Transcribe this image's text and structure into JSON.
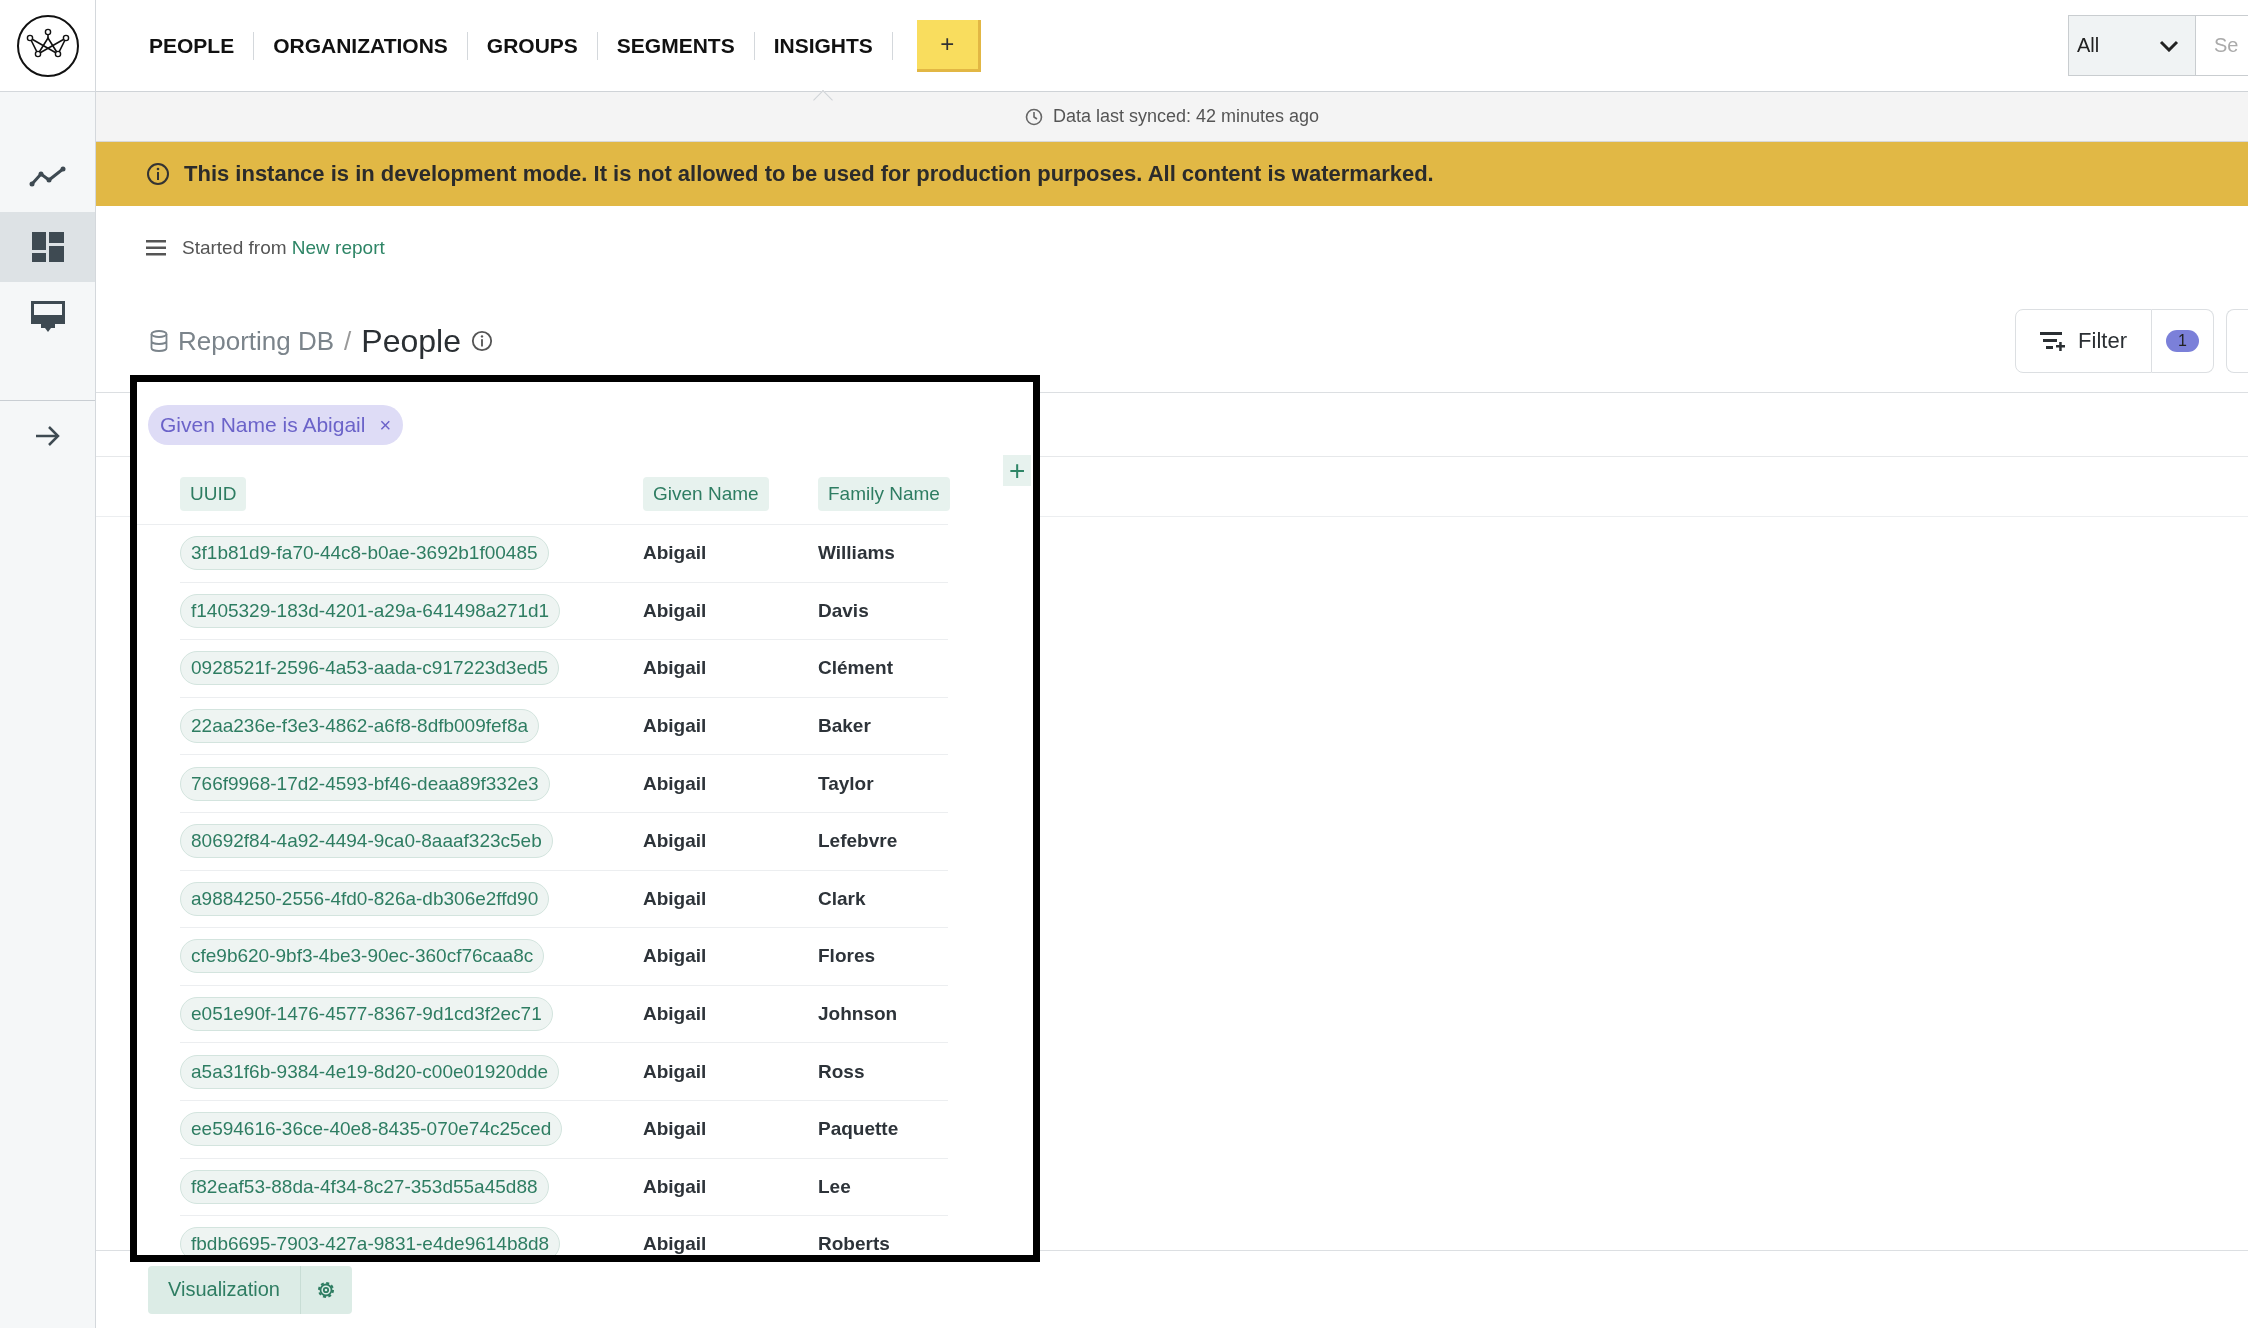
{
  "nav": {
    "items": [
      {
        "label": "PEOPLE",
        "selected": false
      },
      {
        "label": "ORGANIZATIONS",
        "selected": false
      },
      {
        "label": "GROUPS",
        "selected": false
      },
      {
        "label": "SEGMENTS",
        "selected": false
      },
      {
        "label": "INSIGHTS",
        "selected": true
      }
    ],
    "add_button": "+"
  },
  "scope_select": {
    "value": "All"
  },
  "search": {
    "placeholder": "Se"
  },
  "sync_status": "Data last synced: 42 minutes ago",
  "banner": "This instance is in development mode. It is not allowed to be used for production purposes. All content is watermarked.",
  "sidebar": {
    "items": [
      {
        "kind": "trend",
        "selected": false
      },
      {
        "kind": "dashboard",
        "selected": true
      },
      {
        "kind": "presentation",
        "selected": false
      }
    ]
  },
  "source": {
    "prefix": "Started from",
    "link": "New report"
  },
  "breadcrumb": {
    "database": "Reporting DB",
    "separator": "/",
    "table": "People"
  },
  "filter_button": {
    "label": "Filter",
    "count": "1"
  },
  "active_filters": [
    {
      "label": "Given Name is Abigail",
      "remove": "×"
    }
  ],
  "table": {
    "columns": [
      "UUID",
      "Given Name",
      "Family Name"
    ],
    "add_column": "+",
    "rows": [
      [
        "3f1b81d9-fa70-44c8-b0ae-3692b1f00485",
        "Abigail",
        "Williams"
      ],
      [
        "f1405329-183d-4201-a29a-641498a271d1",
        "Abigail",
        "Davis"
      ],
      [
        "0928521f-2596-4a53-aada-c917223d3ed5",
        "Abigail",
        "Clément"
      ],
      [
        "22aa236e-f3e3-4862-a6f8-8dfb009fef8a",
        "Abigail",
        "Baker"
      ],
      [
        "766f9968-17d2-4593-bf46-deaa89f332e3",
        "Abigail",
        "Taylor"
      ],
      [
        "80692f84-4a92-4494-9ca0-8aaaf323c5eb",
        "Abigail",
        "Lefebvre"
      ],
      [
        "a9884250-2556-4fd0-826a-db306e2ffd90",
        "Abigail",
        "Clark"
      ],
      [
        "cfe9b620-9bf3-4be3-90ec-360cf76caa8c",
        "Abigail",
        "Flores"
      ],
      [
        "e051e90f-1476-4577-8367-9d1cd3f2ec71",
        "Abigail",
        "Johnson"
      ],
      [
        "a5a31f6b-9384-4e19-8d20-c00e01920dde",
        "Abigail",
        "Ross"
      ],
      [
        "ee594616-36ce-40e8-8435-070e74c25ced",
        "Abigail",
        "Paquette"
      ],
      [
        "f82eaf53-88da-4f34-8c27-353d55a45d88",
        "Abigail",
        "Lee"
      ],
      [
        "fbdb6695-7903-427a-9831-e4de9614b8d8",
        "Abigail",
        "Roberts"
      ]
    ]
  },
  "footer": {
    "visualization_button": "Visualization"
  }
}
